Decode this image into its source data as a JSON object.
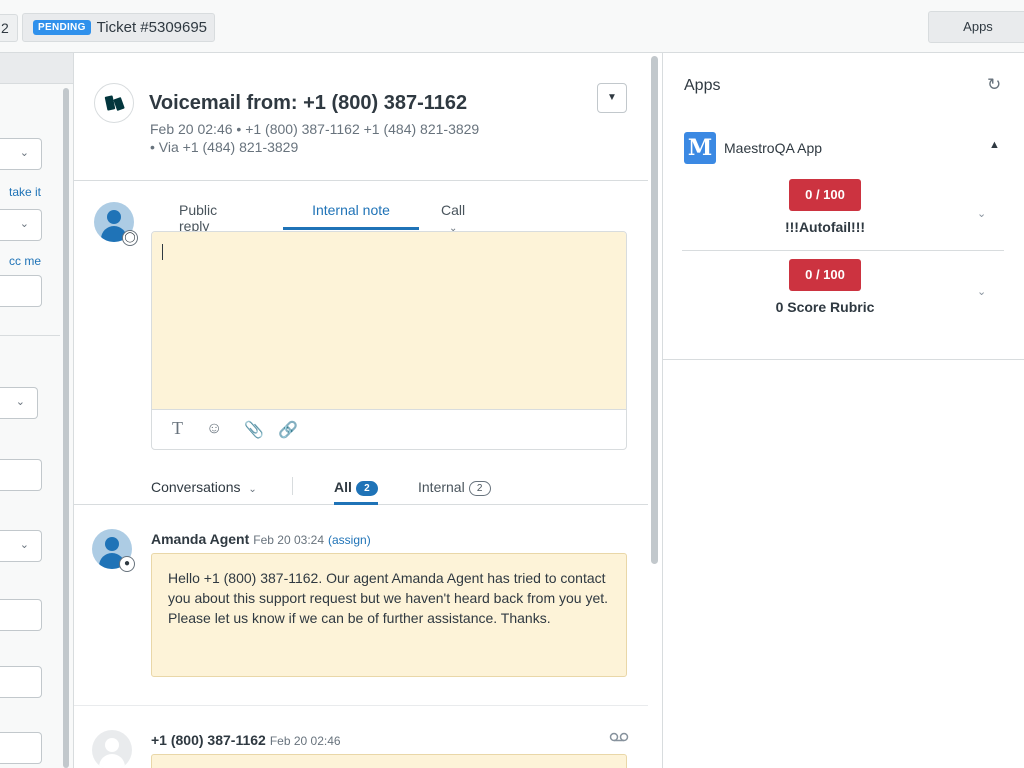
{
  "topbar": {
    "prev_tab_label": "2",
    "ticket_status": "PENDING",
    "ticket_title": "Ticket #5309695",
    "apps_button": "Apps"
  },
  "left_panel": {
    "take_it_link": "take it",
    "cc_me_link": "cc me"
  },
  "ticket": {
    "subject": "Voicemail from: +1 (800) 387-1162",
    "meta_line1": "Feb 20 02:46 • +1 (800) 387-1162   +1 (484) 821-3829",
    "meta_line2": "• Via +1 (484) 821-3829"
  },
  "composer": {
    "tabs": [
      {
        "label": "Public reply",
        "active": false
      },
      {
        "label": "Internal note",
        "active": true
      },
      {
        "label": "Call",
        "active": false
      }
    ],
    "toolbar_icons": [
      "text-format-icon",
      "emoji-icon",
      "attachment-icon",
      "link-icon"
    ]
  },
  "filters": {
    "conversations_label": "Conversations",
    "all_label": "All",
    "all_count": "2",
    "internal_label": "Internal",
    "internal_count": "2"
  },
  "events": [
    {
      "author": "Amanda Agent",
      "time": "Feb 20 03:24",
      "action": "(assign)",
      "body": "Hello +1 (800) 387-1162. Our agent Amanda Agent has tried to contact you about this support request but we haven't heard back from you yet. Please let us know if we can be of further assistance. Thanks."
    },
    {
      "author": "+1 (800) 387-1162",
      "time": "Feb 20 02:46",
      "icon": "voicemail-icon"
    }
  ],
  "apps_panel": {
    "title": "Apps",
    "app_name": "MaestroQA App",
    "app_logo_letter": "M",
    "rubrics": [
      {
        "score": "0 / 100",
        "name": "!!!Autofail!!!"
      },
      {
        "score": "0 / 100",
        "name": "0 Score Rubric"
      }
    ]
  },
  "colors": {
    "accent": "#1f73b7",
    "pending_badge": "#3091ec",
    "internal_note_bg": "#fdf3d8",
    "score_badge": "#cc3340",
    "maestro_logo": "#3b89e3"
  }
}
